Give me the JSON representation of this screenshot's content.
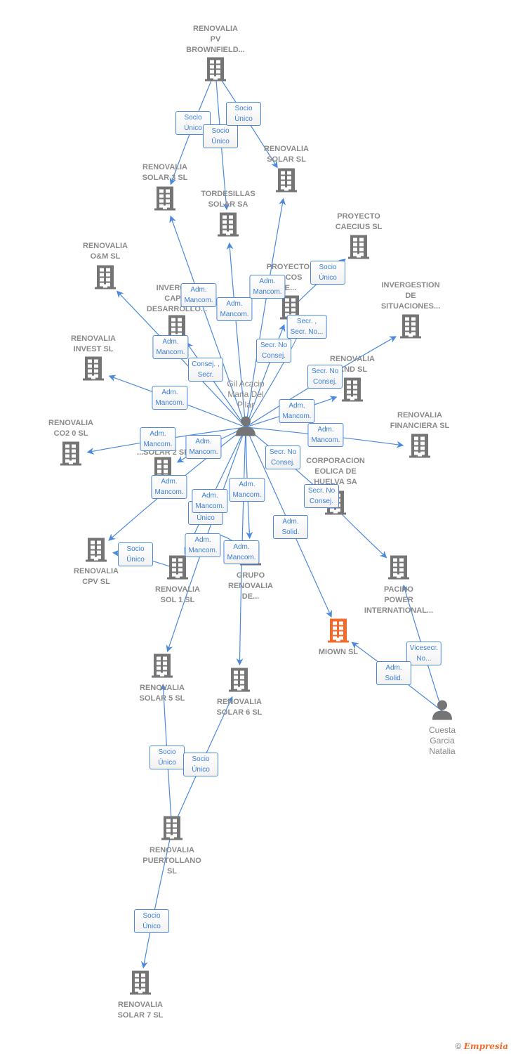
{
  "colors": {
    "edge": "#4a89dc",
    "node_icon": "#757575",
    "highlight": "#f26b2a"
  },
  "nodes": [
    {
      "id": "pv",
      "type": "company",
      "label": "RENOVALIA\nPV\nBROWNFIELD..."
    },
    {
      "id": "solar",
      "type": "company",
      "label": "RENOVALIA\nSOLAR SL"
    },
    {
      "id": "solar3",
      "type": "company",
      "label": "RENOVALIA\nSOLAR 3 SL"
    },
    {
      "id": "tord",
      "type": "company",
      "label": "TORDESILLAS\nSOLAR SA"
    },
    {
      "id": "caecius",
      "type": "company",
      "label": "PROYECTO\nCAECIUS SL"
    },
    {
      "id": "om",
      "type": "company",
      "label": "RENOVALIA\nO&M  SL"
    },
    {
      "id": "proy",
      "type": "company",
      "label": "PROYECTOS\n...COS\nE..."
    },
    {
      "id": "invsit",
      "type": "company",
      "label": "INVERGESTION\nDE\nSITUACIONES..."
    },
    {
      "id": "invcap",
      "type": "company",
      "label": "INVERGE...\nCAPI...\nDESARROLLO..."
    },
    {
      "id": "invest",
      "type": "company",
      "label": "RENOVALIA\nINVEST SL"
    },
    {
      "id": "wind",
      "type": "company",
      "label": "RENOVALIA\n...ND SL"
    },
    {
      "id": "gil",
      "type": "person",
      "label": "Gil Acacio\nMaria Del\nPilar"
    },
    {
      "id": "co2",
      "type": "company",
      "label": "RENOVALIA\nCO2 0 SL"
    },
    {
      "id": "fin",
      "type": "company",
      "label": "RENOVALIA\nFINANCIERA SL"
    },
    {
      "id": "solar2",
      "type": "company",
      "label": "...SOLAR 2 SL"
    },
    {
      "id": "corp",
      "type": "company",
      "label": "CORPORACION\nEOLICA DE\nHUELVA SA"
    },
    {
      "id": "cpv",
      "type": "company",
      "label": "RENOVALIA\nCPV SL"
    },
    {
      "id": "sol1",
      "type": "company",
      "label": "RENOVALIA\nSOL 1 SL"
    },
    {
      "id": "grupo",
      "type": "company",
      "label": "GRUPO\nRENOVALIA\nDE..."
    },
    {
      "id": "pacino",
      "type": "company",
      "label": "PACINO\nPOWER\nINTERNATIONAL..."
    },
    {
      "id": "miown",
      "type": "main",
      "label": "MIOWN  SL"
    },
    {
      "id": "cuesta",
      "type": "person",
      "label": "Cuesta\nGarcia\nNatalia"
    },
    {
      "id": "solar5",
      "type": "company",
      "label": "RENOVALIA\nSOLAR 5 SL"
    },
    {
      "id": "solar6",
      "type": "company",
      "label": "RENOVALIA\nSOLAR 6  SL"
    },
    {
      "id": "puerto",
      "type": "company",
      "label": "RENOVALIA\nPUERTOLLANO\nSL"
    },
    {
      "id": "solar7",
      "type": "company",
      "label": "RENOVALIA\nSOLAR 7  SL"
    }
  ],
  "edges": [
    {
      "from": "pv",
      "to": "solar3",
      "label": "Socio\nÚnico"
    },
    {
      "from": "pv",
      "to": "tord",
      "label": "Socio\nÚnico"
    },
    {
      "from": "pv",
      "to": "solar",
      "label": "Socio\nÚnico"
    },
    {
      "from": "gil",
      "to": "solar3",
      "label": "Adm.\nMancom."
    },
    {
      "from": "gil",
      "to": "tord",
      "label": "Adm.\nMancom."
    },
    {
      "from": "gil",
      "to": "solar",
      "label": "Adm.\nMancom."
    },
    {
      "from": "proy",
      "to": "caecius",
      "label": "Socio\nÚnico"
    },
    {
      "from": "gil",
      "to": "proy",
      "label": "Secr. ,\nSecr. No..."
    },
    {
      "from": "gil",
      "to": "proy",
      "label": "Secr.  No\nConsej."
    },
    {
      "from": "gil",
      "to": "om",
      "label": "Adm.\nMancom."
    },
    {
      "from": "gil",
      "to": "invcap",
      "label": "Consej. ,\nSecr."
    },
    {
      "from": "gil",
      "to": "invest",
      "label": "Adm.\nMancom."
    },
    {
      "from": "gil",
      "to": "invsit",
      "label": "Secr.  No\nConsej."
    },
    {
      "from": "gil",
      "to": "wind",
      "label": "Adm.\nMancom."
    },
    {
      "from": "gil",
      "to": "fin",
      "label": "Adm.\nMancom."
    },
    {
      "from": "gil",
      "to": "co2",
      "label": "Adm.\nMancom."
    },
    {
      "from": "gil",
      "to": "solar2",
      "label": "Adm.\nMancom."
    },
    {
      "from": "gil",
      "to": "corp",
      "label": "Secr.  No\nConsej."
    },
    {
      "from": "gil",
      "to": "cpv",
      "label": "Adm.\nMancom."
    },
    {
      "from": "grupo",
      "to": "sol1",
      "label": "Socio\nÚnico"
    },
    {
      "from": "gil",
      "to": "sol1",
      "label": "Adm.\nMancom."
    },
    {
      "from": "gil",
      "to": "grupo",
      "label": "Adm.\nMancom."
    },
    {
      "from": "corp",
      "to": "pacino",
      "label": "Secr.  No\nConsej."
    },
    {
      "from": "gil",
      "to": "miown",
      "label": "Adm.\nSolid."
    },
    {
      "from": "sol1",
      "to": "cpv",
      "label": "Socio\nÚnico"
    },
    {
      "from": "gil",
      "to": "solar5",
      "label": "Adm.\nMancom."
    },
    {
      "from": "gil",
      "to": "solar6",
      "label": "Adm.\nMancom."
    },
    {
      "from": "cuesta",
      "to": "pacino",
      "label": "Vicesecr.\nNo..."
    },
    {
      "from": "cuesta",
      "to": "miown",
      "label": "Adm.\nSolid."
    },
    {
      "from": "puerto",
      "to": "solar5",
      "label": "Socio\nÚnico"
    },
    {
      "from": "puerto",
      "to": "solar6",
      "label": "Socio\nÚnico"
    },
    {
      "from": "puerto",
      "to": "solar7",
      "label": "Socio\nÚnico"
    }
  ],
  "footer": {
    "copyright": "©",
    "brand": "Empresia"
  }
}
